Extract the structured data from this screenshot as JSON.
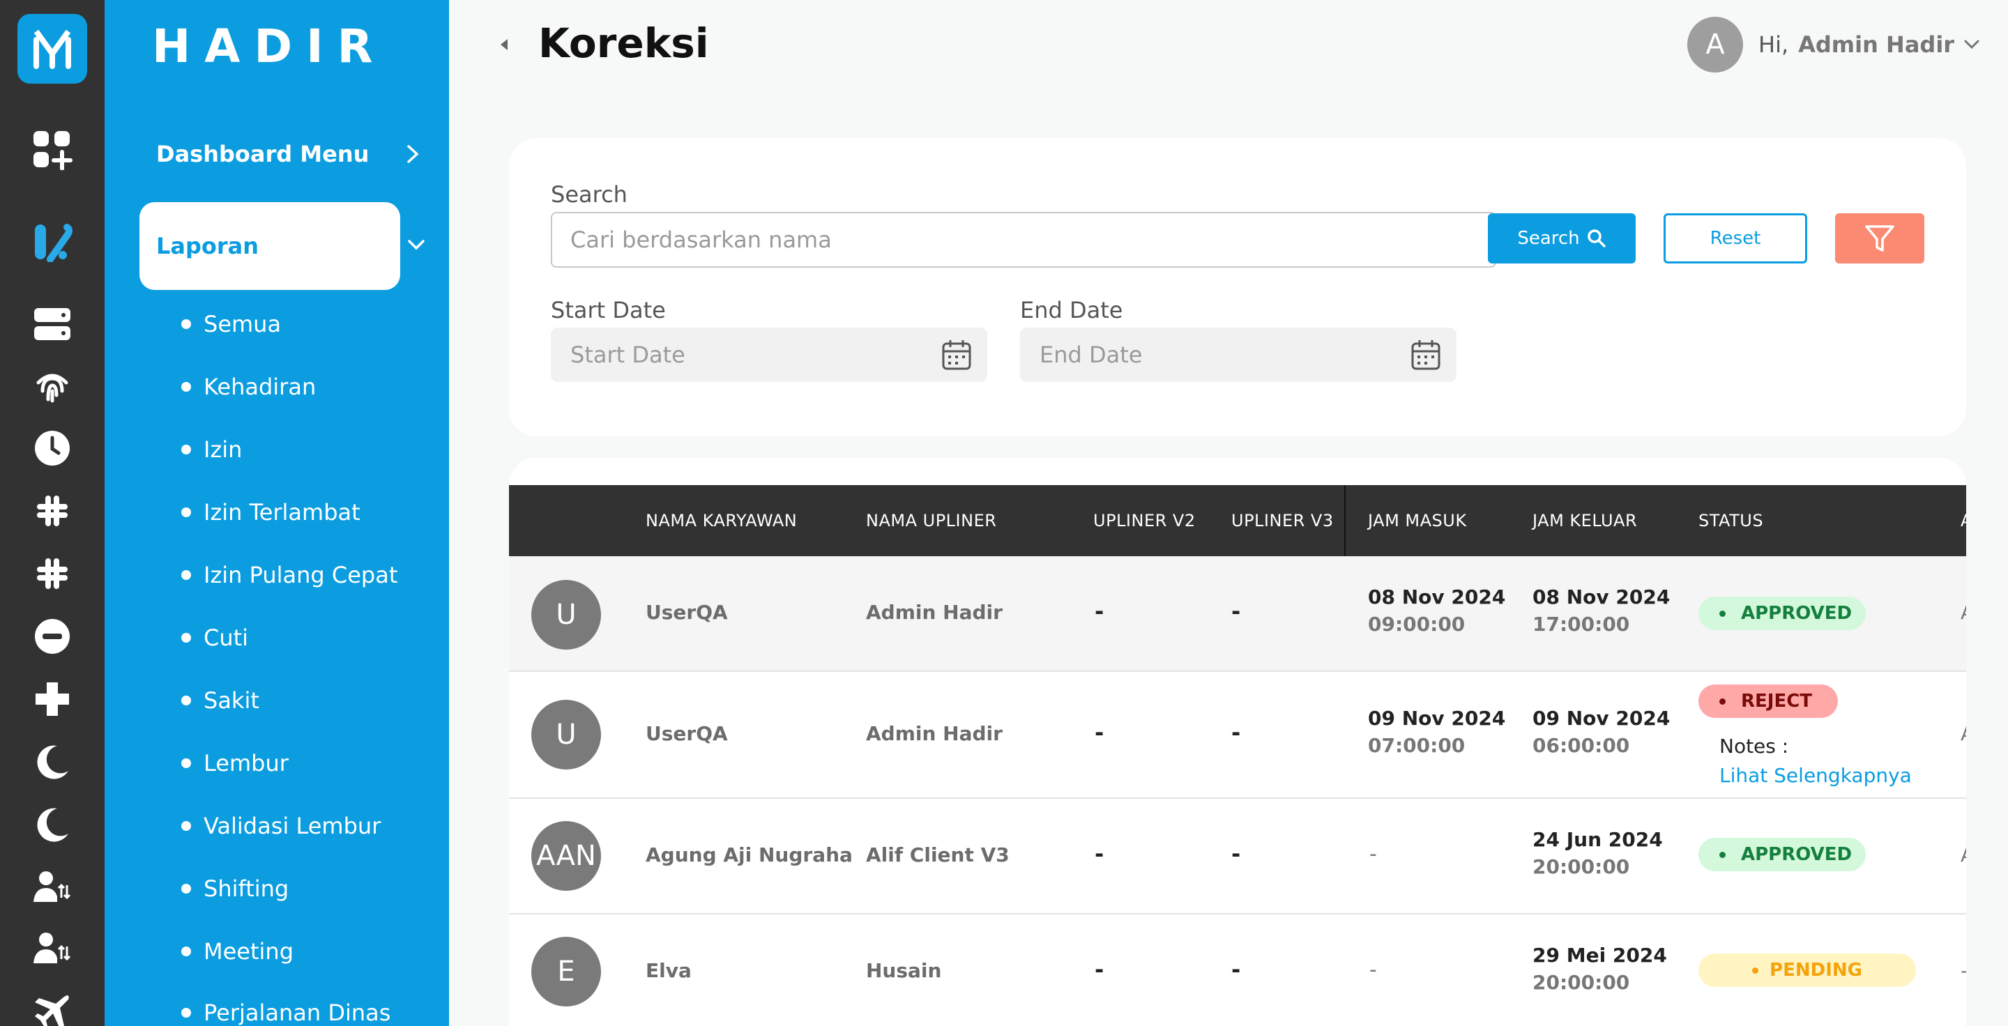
{
  "app": {
    "brand": "HADIR"
  },
  "header": {
    "title": "Koreksi",
    "user_initial": "A",
    "greeting": "Hi,",
    "user_name": "Admin Hadir"
  },
  "sidebar": {
    "dashboard_label": "Dashboard Menu",
    "active_label": "Laporan",
    "sub_items": [
      "Semua",
      "Kehadiran",
      "Izin",
      "Izin Terlambat",
      "Izin Pulang Cepat",
      "Cuti",
      "Sakit",
      "Lembur",
      "Validasi Lembur",
      "Shifting",
      "Meeting",
      "Perjalanan Dinas"
    ]
  },
  "rail_icons": [
    "dashboard-add-icon",
    "report-icon",
    "server-icon",
    "fingerprint-icon",
    "clock-icon",
    "grid-hash-icon",
    "grid-hash-icon-2",
    "minus-circle-icon",
    "plus-icon",
    "moon-icon",
    "moon-icon-2",
    "user-swap-icon",
    "user-swap-icon-2",
    "airplane-icon"
  ],
  "filter": {
    "search_label": "Search",
    "search_placeholder": "Cari berdasarkan nama",
    "search_button": "Search",
    "reset_button": "Reset",
    "start_label": "Start Date",
    "start_placeholder": "Start Date",
    "end_label": "End Date",
    "end_placeholder": "End Date"
  },
  "table": {
    "columns": [
      "NAMA KARYAWAN",
      "NAMA UPLINER",
      "UPLINER V2",
      "UPLINER V3",
      "JAM MASUK",
      "JAM KELUAR",
      "STATUS"
    ],
    "rows": [
      {
        "initials": "U",
        "name": "UserQA",
        "upliner": "Admin Hadir",
        "v2": "-",
        "v3": "-",
        "in_date": "08 Nov 2024",
        "in_time": "09:00:00",
        "out_date": "08 Nov 2024",
        "out_time": "17:00:00",
        "status": "APPROVED",
        "trail": "A"
      },
      {
        "initials": "U",
        "name": "UserQA",
        "upliner": "Admin Hadir",
        "v2": "-",
        "v3": "-",
        "in_date": "09 Nov 2024",
        "in_time": "07:00:00",
        "out_date": "09 Nov 2024",
        "out_time": "06:00:00",
        "status": "REJECT",
        "notes_label": "Notes :",
        "notes_link": "Lihat Selengkapnya",
        "trail": "A"
      },
      {
        "initials": "AAN",
        "name": "Agung Aji Nugraha",
        "upliner": "Alif Client V3",
        "v2": "-",
        "v3": "-",
        "in_plain": "-",
        "out_date": "24 Jun 2024",
        "out_time": "20:00:00",
        "status": "APPROVED",
        "trail": "A"
      },
      {
        "initials": "E",
        "name": "Elva",
        "upliner": "Husain",
        "v2": "-",
        "v3": "-",
        "in_plain": "-",
        "out_date": "29 Mei 2024",
        "out_time": "20:00:00",
        "status": "PENDING",
        "trail": "-"
      }
    ]
  },
  "colors": {
    "primary": "#0b9de0",
    "rail": "#323232",
    "filter_button": "#fa8a72",
    "approved_bg": "#d3f8db",
    "reject_bg": "#ffa8a8",
    "pending_bg": "#fff4c2"
  }
}
